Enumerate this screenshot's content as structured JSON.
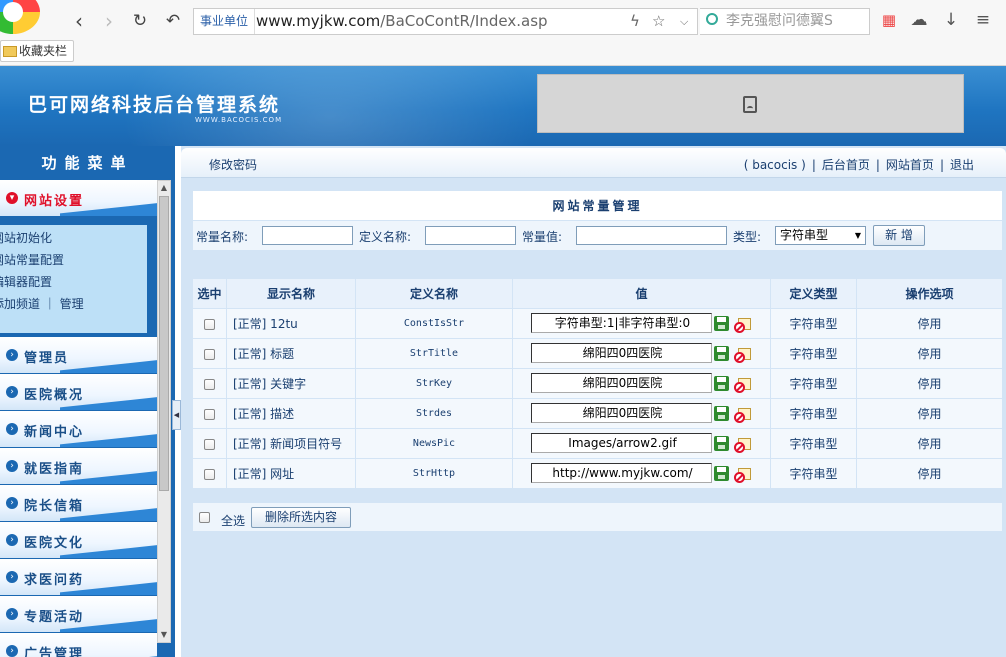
{
  "browser": {
    "url_tag": "事业单位",
    "url_host": "www.myjkw.com",
    "url_path": "/BaCoContR/Index.asp",
    "search_placeholder": "李克强慰问德翼S",
    "bookmark_folder": "收藏夹栏"
  },
  "header": {
    "title": "巴可网络科技后台管理系统",
    "subtitle": "WWW.BACOCIS.COM"
  },
  "menu": {
    "title": "功能菜单",
    "items": [
      {
        "label": "网站设置",
        "active": true
      },
      {
        "label": "管理员"
      },
      {
        "label": "医院概况"
      },
      {
        "label": "新闻中心"
      },
      {
        "label": "就医指南"
      },
      {
        "label": "院长信箱"
      },
      {
        "label": "医院文化"
      },
      {
        "label": "求医问药"
      },
      {
        "label": "专题活动"
      },
      {
        "label": "广告管理"
      }
    ],
    "sub_items": [
      "网站初始化",
      "网站常量配置",
      "编辑器配置",
      "添加频道 ｜ 管理"
    ]
  },
  "topbar": {
    "change_password": "修改密码",
    "user": "( bacocis )",
    "home_admin": "后台首页",
    "home_site": "网站首页",
    "logout": "退出"
  },
  "panel": {
    "title": "网站常量管理",
    "filter": {
      "const_name_label": "常量名称:",
      "def_name_label": "定义名称:",
      "const_value_label": "常量值:",
      "type_label": "类型:",
      "type_selected": "字符串型",
      "add_button": "新 增"
    }
  },
  "table": {
    "headers": [
      "选中",
      "显示名称",
      "定义名称",
      "值",
      "定义类型",
      "操作选项"
    ],
    "rows": [
      {
        "display": "[正常] 12tu",
        "def": "ConstIsStr",
        "value": "字符串型:1|非字符串型:0",
        "type": "字符串型",
        "op": "停用"
      },
      {
        "display": "[正常] 标题",
        "def": "StrTitle",
        "value": "绵阳四0四医院",
        "type": "字符串型",
        "op": "停用"
      },
      {
        "display": "[正常] 关键字",
        "def": "StrKey",
        "value": "绵阳四0四医院",
        "type": "字符串型",
        "op": "停用"
      },
      {
        "display": "[正常] 描述",
        "def": "Strdes",
        "value": "绵阳四0四医院",
        "type": "字符串型",
        "op": "停用"
      },
      {
        "display": "[正常] 新闻项目符号",
        "def": "NewsPic",
        "value": "Images/arrow2.gif",
        "type": "字符串型",
        "op": "停用"
      },
      {
        "display": "[正常] 网址",
        "def": "StrHttp",
        "value": "http://www.myjkw.com/",
        "type": "字符串型",
        "op": "停用"
      }
    ]
  },
  "bottom": {
    "select_all": "全选",
    "delete_selected": "删除所选内容"
  }
}
